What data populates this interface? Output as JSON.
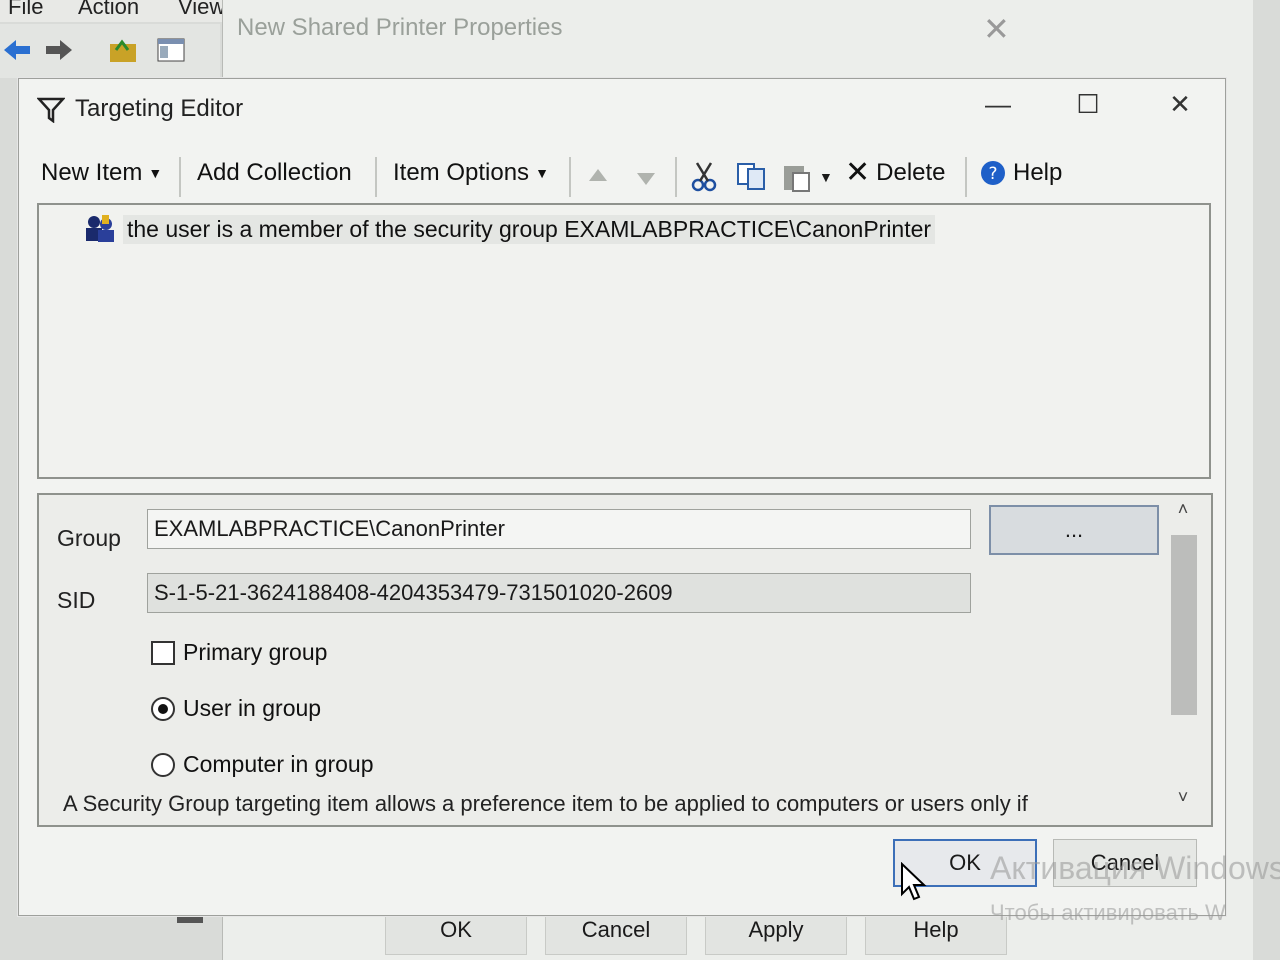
{
  "background_window": {
    "menu": [
      "File",
      "Action",
      "View"
    ],
    "dialog_title": "New Shared Printer Properties",
    "close_glyph": "✕",
    "buttons": {
      "ok": "OK",
      "cancel": "Cancel",
      "apply": "Apply",
      "help": "Help"
    }
  },
  "editor": {
    "title": "Targeting Editor",
    "window_controls": {
      "minimize": "—",
      "maximize": "☐",
      "close": "✕"
    },
    "toolbar": {
      "new_item": "New Item",
      "add_collection": "Add Collection",
      "item_options": "Item Options",
      "delete": "Delete",
      "help": "Help"
    },
    "tree_item": "the user is a member of the security group EXAMLABPRACTICE\\CanonPrinter",
    "details": {
      "group_label": "Group",
      "group_value": "EXAMLABPRACTICE\\CanonPrinter",
      "browse_label": "...",
      "sid_label": "SID",
      "sid_value": "S-1-5-21-3624188408-4204353479-731501020-2609",
      "primary_group_label": "Primary group",
      "primary_group_checked": false,
      "user_in_group_label": "User in group",
      "computer_in_group_label": "Computer in group",
      "selected_option": "User in group",
      "description": "A Security Group targeting item allows a preference item to be applied to computers or users only if"
    },
    "buttons": {
      "ok": "OK",
      "cancel": "Cancel"
    }
  },
  "watermark": {
    "line1": "Активация Windows",
    "line2": "Чтобы активировать W"
  },
  "colors": {
    "accent": "#3c6fb8",
    "side_strip": "#1f3fb8",
    "help_icon": "#1e5fc8"
  }
}
